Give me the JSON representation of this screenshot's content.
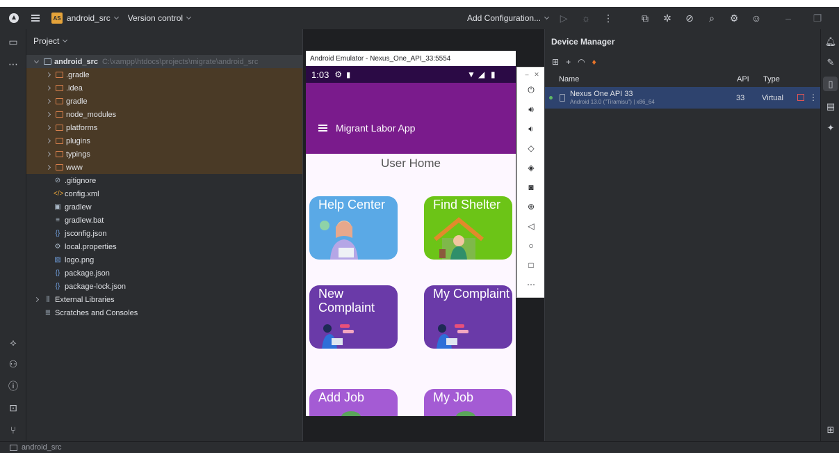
{
  "window": {
    "project_badge": "AS",
    "project_name": "android_src",
    "vcs_label": "Version control",
    "run_config": "Add Configuration..."
  },
  "project_panel": {
    "title": "Project",
    "root_name": "android_src",
    "root_path": "C:\\xampp\\htdocs\\projects\\migrate\\android_src",
    "folders": [
      ".gradle",
      ".idea",
      "gradle",
      "node_modules",
      "platforms",
      "plugins",
      "typings",
      "www"
    ],
    "files": [
      {
        "name": ".gitignore",
        "icon": "ignore-icon"
      },
      {
        "name": "config.xml",
        "icon": "xml-icon"
      },
      {
        "name": "gradlew",
        "icon": "script-icon"
      },
      {
        "name": "gradlew.bat",
        "icon": "bat-icon"
      },
      {
        "name": "jsconfig.json",
        "icon": "json-icon"
      },
      {
        "name": "local.properties",
        "icon": "properties-icon"
      },
      {
        "name": "logo.png",
        "icon": "image-icon"
      },
      {
        "name": "package.json",
        "icon": "json-icon"
      },
      {
        "name": "package-lock.json",
        "icon": "json-icon"
      }
    ],
    "external_libraries": "External Libraries",
    "scratches": "Scratches and Consoles"
  },
  "emulator": {
    "window_title": "Android Emulator - Nexus_One_API_33:5554",
    "status_time": "1:03",
    "app_title": "Migrant Labor App",
    "page_heading": "User Home",
    "tiles": [
      {
        "label": "Help Center",
        "color": "#5aa9e6"
      },
      {
        "label": "Find Shelter",
        "color": "#6cc417"
      },
      {
        "label": "New Complaint",
        "color": "#6a3aa8"
      },
      {
        "label": "My Complaint",
        "color": "#6a3aa8"
      },
      {
        "label": "Add Job",
        "color": "#a45bd4"
      },
      {
        "label": "My Job",
        "color": "#a45bd4"
      }
    ]
  },
  "device_manager": {
    "title": "Device Manager",
    "columns": {
      "name": "Name",
      "api": "API",
      "type": "Type"
    },
    "devices": [
      {
        "name": "Nexus One API 33",
        "detail": "Android 13.0 (\"Tiramisu\") | x86_64",
        "api": "33",
        "type": "Virtual",
        "status": "running"
      }
    ]
  },
  "statusbar": {
    "project": "android_src"
  },
  "colors": {
    "ide_bg": "#2b2d30",
    "editor_bg": "#1e1f22",
    "app_bar": "#7a1b8c",
    "selection": "#2e436e"
  }
}
